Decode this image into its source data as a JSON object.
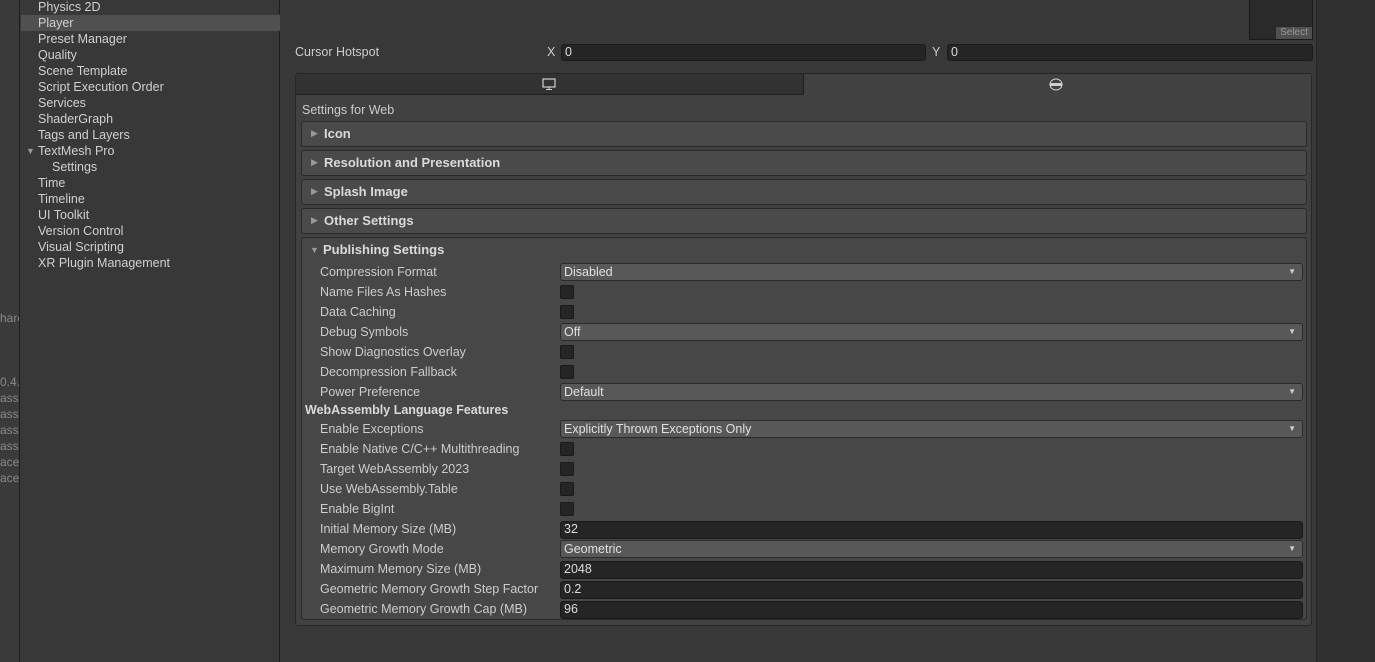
{
  "left_strip": {
    "texts": [
      "hare",
      "0.4.",
      "ass",
      "ass",
      "ass",
      "ass",
      "ace",
      "ace"
    ]
  },
  "sidebar": {
    "items": [
      {
        "label": "Physics 2D"
      },
      {
        "label": "Player",
        "selected": true
      },
      {
        "label": "Preset Manager"
      },
      {
        "label": "Quality"
      },
      {
        "label": "Scene Template"
      },
      {
        "label": "Script Execution Order"
      },
      {
        "label": "Services"
      },
      {
        "label": "ShaderGraph"
      },
      {
        "label": "Tags and Layers"
      },
      {
        "label": "TextMesh Pro",
        "expanded": true
      },
      {
        "label": "Settings",
        "child": true
      },
      {
        "label": "Time"
      },
      {
        "label": "Timeline"
      },
      {
        "label": "UI Toolkit"
      },
      {
        "label": "Version Control"
      },
      {
        "label": "Visual Scripting"
      },
      {
        "label": "XR Plugin Management"
      }
    ]
  },
  "texture": {
    "select_label": "Select"
  },
  "cursor_hotspot": {
    "label": "Cursor Hotspot",
    "x_label": "X",
    "x_value": "0",
    "y_label": "Y",
    "y_value": "0"
  },
  "platform_tabs": [
    {
      "icon": "monitor-icon"
    },
    {
      "icon": "web-icon",
      "selected": true
    }
  ],
  "settings_title": "Settings for Web",
  "foldouts": [
    {
      "label": "Icon"
    },
    {
      "label": "Resolution and Presentation"
    },
    {
      "label": "Splash Image"
    },
    {
      "label": "Other Settings"
    }
  ],
  "publishing": {
    "label": "Publishing Settings",
    "rows": [
      {
        "label": "Compression Format",
        "type": "dropdown",
        "value": "Disabled"
      },
      {
        "label": "Name Files As Hashes",
        "type": "checkbox",
        "checked": false
      },
      {
        "label": "Data Caching",
        "type": "checkbox",
        "checked": false
      },
      {
        "label": "Debug Symbols",
        "type": "dropdown",
        "value": "Off"
      },
      {
        "label": "Show Diagnostics Overlay",
        "type": "checkbox",
        "checked": false
      },
      {
        "label": "Decompression Fallback",
        "type": "checkbox",
        "checked": false
      },
      {
        "label": "Power Preference",
        "type": "dropdown",
        "value": "Default"
      }
    ],
    "wasm_header": "WebAssembly Language Features",
    "wasm_rows": [
      {
        "label": "Enable Exceptions",
        "type": "dropdown",
        "value": "Explicitly Thrown Exceptions Only"
      },
      {
        "label": "Enable Native C/C++ Multithreading",
        "type": "checkbox",
        "checked": false
      },
      {
        "label": "Target WebAssembly 2023",
        "type": "checkbox",
        "checked": false
      },
      {
        "label": "Use WebAssembly.Table",
        "type": "checkbox",
        "checked": false
      },
      {
        "label": "Enable BigInt",
        "type": "checkbox",
        "checked": false
      },
      {
        "label": "Initial Memory Size (MB)",
        "type": "text",
        "value": "32"
      },
      {
        "label": "Memory Growth Mode",
        "type": "dropdown",
        "value": "Geometric"
      },
      {
        "label": "Maximum Memory Size (MB)",
        "type": "text",
        "value": "2048"
      },
      {
        "label": "Geometric Memory Growth Step Factor",
        "type": "text",
        "value": "0.2"
      },
      {
        "label": "Geometric Memory Growth Cap (MB)",
        "type": "text",
        "value": "96"
      }
    ]
  }
}
